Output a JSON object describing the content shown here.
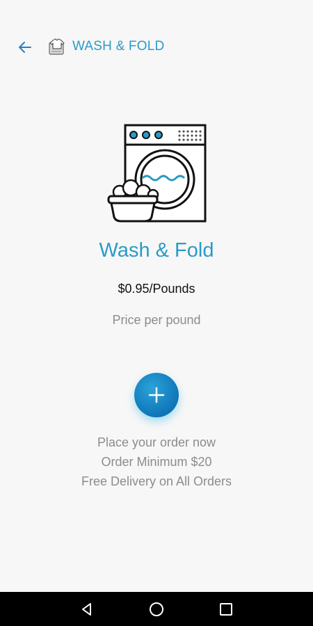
{
  "header": {
    "title": "WASH & FOLD",
    "back_icon": "arrow-left-icon",
    "service_icon": "laundry-shirt-icon"
  },
  "hero": {
    "icon": "washing-machine-icon"
  },
  "service": {
    "title": "Wash & Fold",
    "price": "$0.95/Pounds",
    "price_note": "Price per pound"
  },
  "add_button": {
    "icon": "plus-icon"
  },
  "info": {
    "line1": "Place your order now",
    "line2": "Order Minimum $20",
    "line3": "Free Delivery on All Orders"
  },
  "colors": {
    "accent": "#2a9bc6",
    "button": "#1584c7",
    "background": "#f7f7f7"
  },
  "system_nav": {
    "back": "back-triangle-icon",
    "home": "home-circle-icon",
    "recents": "recents-square-icon"
  }
}
